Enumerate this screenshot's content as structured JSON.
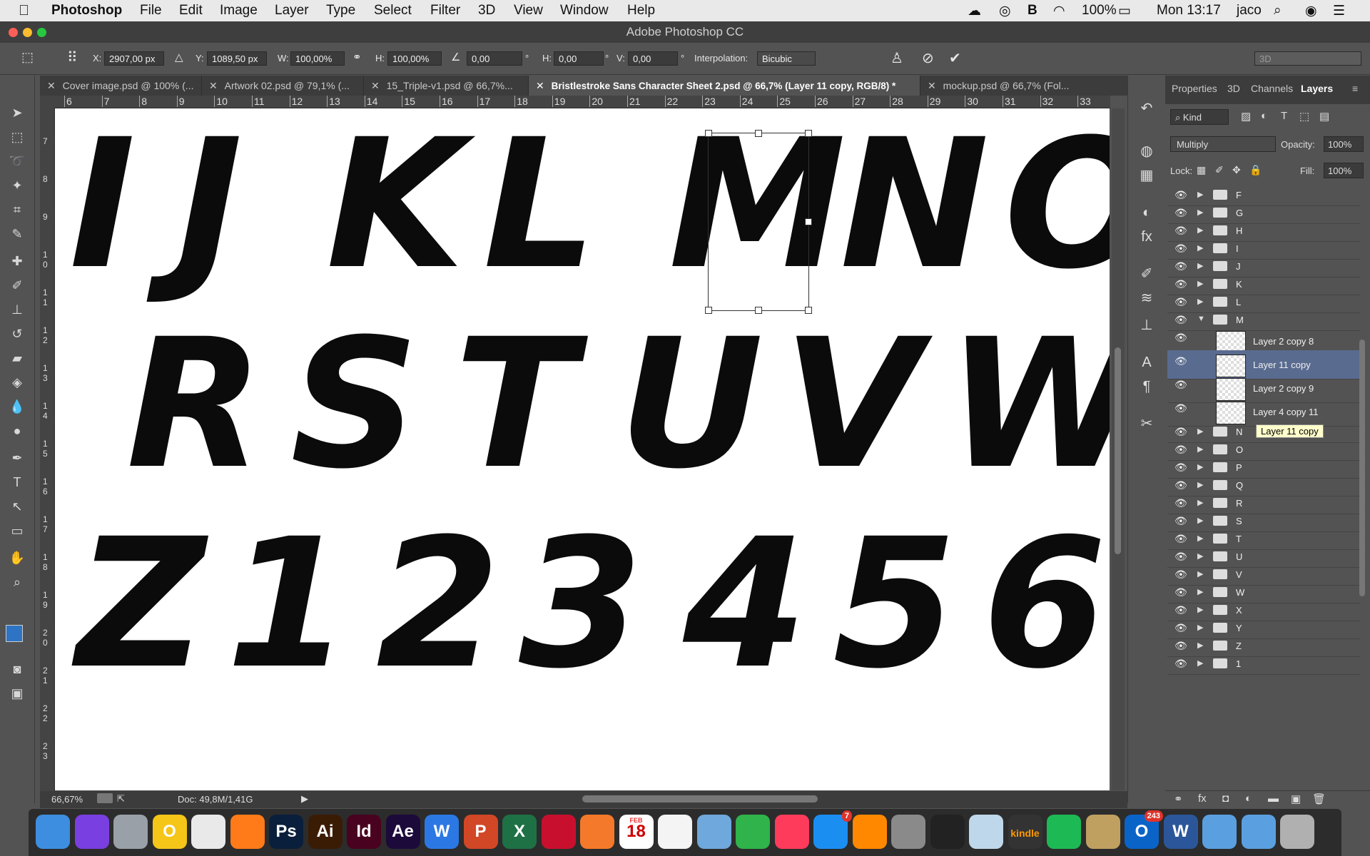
{
  "menubar": {
    "app": "Photoshop",
    "items": [
      "File",
      "Edit",
      "Image",
      "Layer",
      "Type",
      "Select",
      "Filter",
      "3D",
      "View",
      "Window",
      "Help"
    ],
    "status": {
      "battery": "100%",
      "clock": "Mon 13:17",
      "user": "jaco"
    }
  },
  "window": {
    "title": "Adobe Photoshop CC"
  },
  "options": {
    "x_label": "X:",
    "x_value": "2907,00 px",
    "y_label": "Y:",
    "y_value": "1089,50 px",
    "w_label": "W:",
    "w_value": "100,00%",
    "h_label": "H:",
    "h_value": "100,00%",
    "angle_value": "0,00",
    "hskew_label": "H:",
    "hskew_value": "0,00",
    "vskew_label": "V:",
    "vskew_value": "0,00",
    "interp_label": "Interpolation:",
    "interp_value": "Bicubic",
    "workspace": "3D"
  },
  "tabs": [
    {
      "label": "Cover image.psd @ 100% (..."
    },
    {
      "label": "Artwork 02.psd @ 79,1% (..."
    },
    {
      "label": "15_Triple-v1.psd @ 66,7%..."
    },
    {
      "label": "Bristlestroke Sans Character Sheet 2.psd @ 66,7% (Layer 11 copy, RGB/8) *"
    },
    {
      "label": "mockup.psd @ 66,7% (Fol..."
    }
  ],
  "ruler": {
    "h": [
      "6",
      "7",
      "8",
      "9",
      "10",
      "11",
      "12",
      "13",
      "14",
      "15",
      "16",
      "17",
      "18",
      "19",
      "20",
      "21",
      "22",
      "23",
      "24",
      "25",
      "26",
      "27",
      "28",
      "29",
      "30",
      "31",
      "32",
      "33"
    ],
    "v": [
      "7",
      "8",
      "9",
      "10",
      "11",
      "12",
      "13",
      "14",
      "15",
      "16",
      "17",
      "18",
      "19",
      "20",
      "21",
      "22",
      "23"
    ]
  },
  "canvas": {
    "row1": [
      "I",
      "J",
      "K",
      "L",
      "M",
      "N",
      "O"
    ],
    "row2": [
      "R",
      "S",
      "T",
      "U",
      "V",
      "W"
    ],
    "row3": [
      "Z",
      "1",
      "2",
      "3",
      "4",
      "5",
      "6"
    ]
  },
  "status": {
    "zoom": "66,67%",
    "doc": "Doc: 49,8M/1,41G"
  },
  "panel": {
    "tabs": [
      "Properties",
      "3D",
      "Channels",
      "Layers"
    ],
    "filter_kind": "Kind",
    "blend_mode": "Multiply",
    "opacity_label": "Opacity:",
    "opacity_value": "100%",
    "lock_label": "Lock:",
    "fill_label": "Fill:",
    "fill_value": "100%",
    "tooltip": "Layer 11 copy"
  },
  "layers": [
    {
      "name": "F",
      "type": "group"
    },
    {
      "name": "G",
      "type": "group"
    },
    {
      "name": "H",
      "type": "group"
    },
    {
      "name": "I",
      "type": "group"
    },
    {
      "name": "J",
      "type": "group"
    },
    {
      "name": "K",
      "type": "group"
    },
    {
      "name": "L",
      "type": "group"
    },
    {
      "name": "M",
      "type": "group-open"
    },
    {
      "name": "Layer 2 copy 8",
      "type": "layer"
    },
    {
      "name": "Layer 11 copy",
      "type": "layer",
      "selected": true
    },
    {
      "name": "Layer 2 copy 9",
      "type": "layer"
    },
    {
      "name": "Layer 4 copy 11",
      "type": "layer"
    },
    {
      "name": "N",
      "type": "group"
    },
    {
      "name": "O",
      "type": "group"
    },
    {
      "name": "P",
      "type": "group"
    },
    {
      "name": "Q",
      "type": "group"
    },
    {
      "name": "R",
      "type": "group"
    },
    {
      "name": "S",
      "type": "group"
    },
    {
      "name": "T",
      "type": "group"
    },
    {
      "name": "U",
      "type": "group"
    },
    {
      "name": "V",
      "type": "group"
    },
    {
      "name": "W",
      "type": "group"
    },
    {
      "name": "X",
      "type": "group"
    },
    {
      "name": "Y",
      "type": "group"
    },
    {
      "name": "Z",
      "type": "group"
    },
    {
      "name": "1",
      "type": "group"
    }
  ],
  "dock": [
    {
      "name": "finder"
    },
    {
      "name": "siri"
    },
    {
      "name": "launchpad"
    },
    {
      "name": "outlook-o",
      "label": "O"
    },
    {
      "name": "chrome"
    },
    {
      "name": "firefox"
    },
    {
      "name": "photoshop",
      "label": "Ps"
    },
    {
      "name": "illustrator",
      "label": "Ai"
    },
    {
      "name": "indesign",
      "label": "Id"
    },
    {
      "name": "after-effects",
      "label": "Ae"
    },
    {
      "name": "word-w",
      "label": "W"
    },
    {
      "name": "powerpoint-p",
      "label": "P"
    },
    {
      "name": "excel-x",
      "label": "X"
    },
    {
      "name": "sketchup"
    },
    {
      "name": "blender"
    },
    {
      "name": "calendar",
      "label": "18",
      "sub": "FEB"
    },
    {
      "name": "textedit"
    },
    {
      "name": "preview"
    },
    {
      "name": "numbers"
    },
    {
      "name": "itunes"
    },
    {
      "name": "app-store",
      "badge": "7"
    },
    {
      "name": "vlc"
    },
    {
      "name": "system-prefs"
    },
    {
      "name": "unity"
    },
    {
      "name": "cyberduck"
    },
    {
      "name": "kindle",
      "label": "kindle"
    },
    {
      "name": "spotify"
    },
    {
      "name": "keychain"
    },
    {
      "name": "outlook",
      "label": "O",
      "badge": "243"
    },
    {
      "name": "word",
      "label": "W"
    },
    {
      "name": "folder"
    },
    {
      "name": "downloads"
    },
    {
      "name": "trash"
    }
  ],
  "colors": {
    "accent": "#2e6fd1",
    "selected_layer": "#596b8f",
    "foreground": "#2e74c4",
    "background": "#ffffff"
  }
}
